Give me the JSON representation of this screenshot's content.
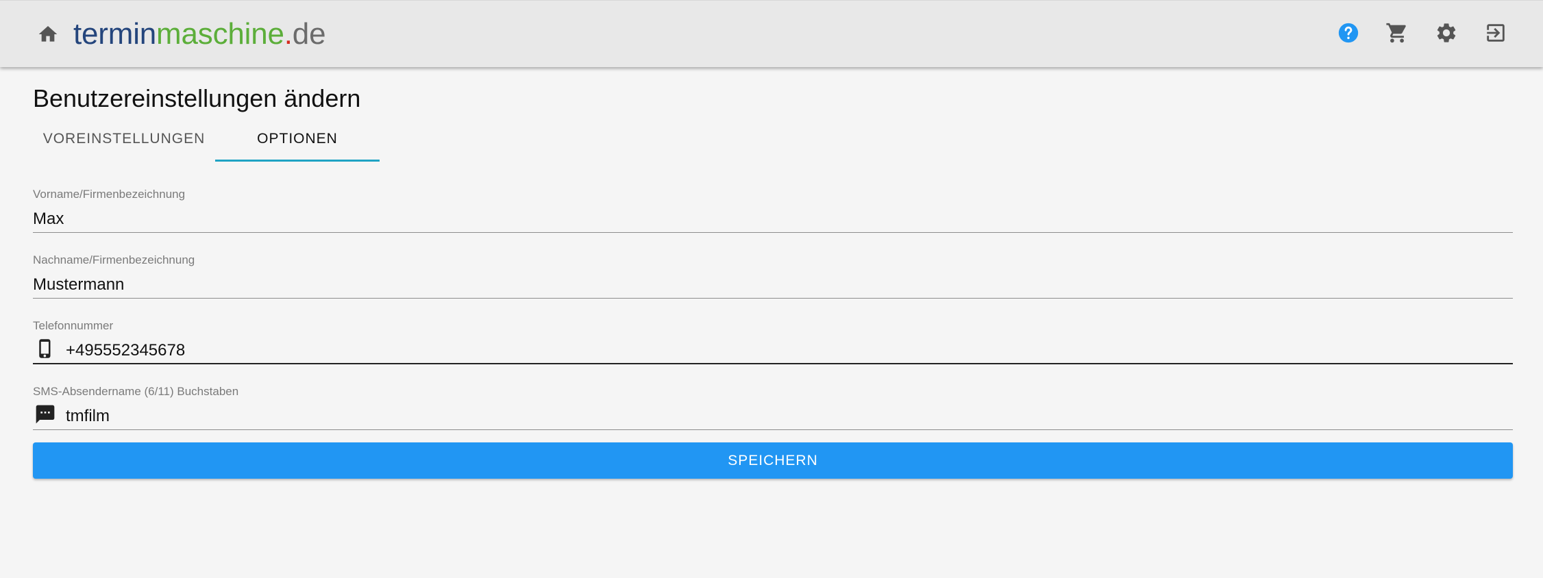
{
  "header": {
    "logo": {
      "part1": "termin",
      "part2": "maschine",
      "part3": ".",
      "part4": "de"
    },
    "icons": {
      "home": "home-icon",
      "help": "help-icon",
      "cart": "cart-icon",
      "settings": "gear-icon",
      "logout": "logout-icon"
    },
    "colors": {
      "logo_blue": "#24457c",
      "logo_green": "#5cae3a",
      "logo_red": "#d62b1f",
      "logo_grey": "#6b6b6b",
      "help_blue": "#2196f3"
    }
  },
  "page": {
    "title": "Benutzereinstellungen ändern"
  },
  "tabs": {
    "items": [
      {
        "label": "VOREINSTELLUNGEN",
        "active": false
      },
      {
        "label": "OPTIONEN",
        "active": true
      }
    ],
    "indicator_color": "#1fa3c4"
  },
  "form": {
    "first_name": {
      "label": "Vorname/Firmenbezeichnung",
      "value": "Max"
    },
    "last_name": {
      "label": "Nachname/Firmenbezeichnung",
      "value": "Mustermann"
    },
    "phone": {
      "label": "Telefonnummer",
      "value": "+495552345678",
      "icon": "smartphone-icon",
      "focused": true
    },
    "sms_sender": {
      "label": "SMS-Absendername (6/11) Buchstaben",
      "value": "tmfilm",
      "icon": "sms-icon"
    }
  },
  "actions": {
    "save_label": "SPEICHERN",
    "save_color": "#2196f3"
  }
}
